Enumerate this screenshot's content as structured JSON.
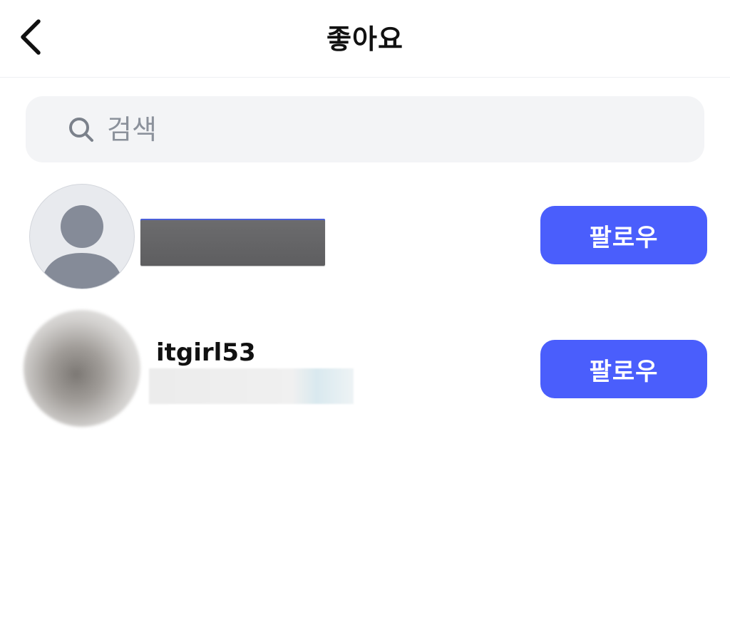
{
  "header": {
    "title": "좋아요",
    "back_icon": "chevron-left-icon"
  },
  "search": {
    "placeholder": "검색",
    "value": "",
    "icon": "search-icon"
  },
  "likers": [
    {
      "username": "",
      "avatar": "default-avatar",
      "follow_label": "팔로우"
    },
    {
      "username": "itgirl53",
      "avatar": "photo-avatar",
      "follow_label": "팔로우"
    }
  ],
  "colors": {
    "accent": "#4a5efc",
    "search_bg": "#f3f4f6",
    "placeholder": "#8b919b",
    "text": "#111111"
  }
}
